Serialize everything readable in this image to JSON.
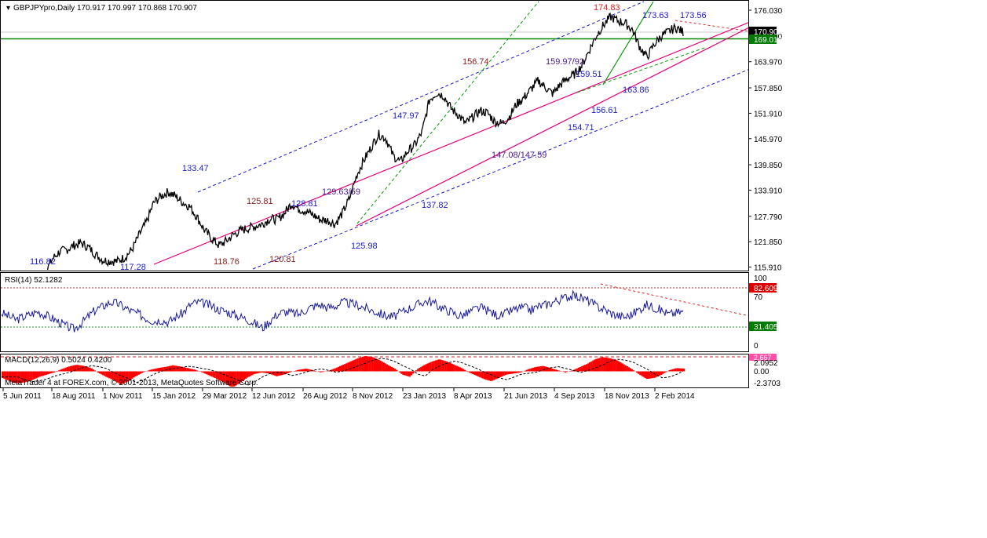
{
  "window": {
    "title": "GBPJPYpro,Daily",
    "ohlc": "170.917 170.997 170.868 170.907",
    "credit": "MetaTrader 4 at FOREX.com, © 2001-2013, MetaQuotes Software Corp."
  },
  "colors": {
    "price_line": "#000000",
    "channel_magenta": "#e8007a",
    "channel_blue": "#1a1acd",
    "trend_green": "#009900",
    "resistance_red": "#dd2222",
    "rsi_line": "#1a1a9a",
    "macd_hist": "#ff0000",
    "support_level": "#008800",
    "grid": "#c8c8c8"
  },
  "chart_data": [
    {
      "type": "line",
      "panel": "price",
      "series": [
        {
          "name": "GBPJPYpro,Daily",
          "values": [
            113.5,
            112.0,
            110.5,
            109.5,
            110.0,
            112.0,
            114.5,
            117.8,
            119.5,
            120.0,
            121.0,
            121.5,
            120.5,
            118.8,
            117.5,
            117.3,
            117.3,
            118.2,
            120.0,
            123.5,
            126.5,
            131.0,
            132.5,
            133.5,
            132.5,
            131.0,
            130.0,
            127.5,
            124.5,
            122.5,
            121.0,
            122.0,
            123.5,
            124.5,
            125.0,
            125.5,
            126.0,
            127.2,
            127.0,
            128.5,
            130.8,
            129.5,
            129.0,
            128.0,
            127.0,
            126.8,
            126.0,
            128.5,
            132.0,
            137.5,
            141.0,
            144.0,
            147.0,
            146.0,
            142.0,
            140.5,
            143.0,
            144.5,
            147.5,
            155.0,
            156.7,
            156.0,
            153.0,
            151.5,
            149.5,
            151.0,
            152.5,
            152.0,
            150.0,
            149.5,
            151.0,
            154.0,
            155.5,
            157.5,
            159.5,
            158.0,
            156.5,
            158.5,
            160.0,
            161.0,
            163.0,
            166.5,
            170.0,
            172.5,
            174.5,
            173.5,
            173.0,
            171.5,
            167.5,
            165.0,
            168.0,
            170.0,
            171.0,
            172.0,
            170.9
          ]
        }
      ],
      "y_axis_ticks": [
        176.03,
        169.99,
        163.97,
        157.85,
        151.91,
        145.97,
        139.85,
        133.91,
        127.79,
        121.85,
        115.91
      ],
      "ylim": [
        114.2,
        177.6
      ],
      "x_tick_labels": [
        "5 Jun 2011",
        "18 Aug 2011",
        "1 Nov 2011",
        "15 Jan 2012",
        "29 Mar 2012",
        "12 Jun 2012",
        "26 Aug 2012",
        "8 Nov 2012",
        "23 Jan 2013",
        "8 Apr 2013",
        "21 Jun 2013",
        "4 Sep 2013",
        "18 Nov 2013",
        "2 Feb 2014"
      ],
      "current_price": "170.907",
      "support_level": "169.016",
      "annotations": [
        "174.83",
        "173.63",
        "173.56",
        "156.74",
        "159.97/92",
        "159.51",
        "163.86",
        "156.61",
        "154.71",
        "147.97",
        "147.08/147.59",
        "137.82",
        "133.47",
        "125.81",
        "128.81",
        "129.63/59",
        "125.98",
        "118.76",
        "120.81",
        "116.82",
        "117.28"
      ]
    },
    {
      "type": "line",
      "panel": "rsi",
      "title": "RSI(14) 52.1282",
      "series": [
        {
          "name": "RSI(14)",
          "values": [
            50,
            45,
            40,
            44,
            48,
            52,
            47,
            42,
            36,
            30,
            26,
            35,
            45,
            55,
            60,
            66,
            64,
            58,
            52,
            48,
            42,
            38,
            40,
            36,
            44,
            50,
            62,
            66,
            64,
            60,
            55,
            52,
            48,
            44,
            40,
            34,
            28,
            38,
            48,
            52,
            50,
            48,
            55,
            60,
            62,
            58,
            60,
            66,
            64,
            62,
            58,
            54,
            50,
            46,
            44,
            50,
            56,
            60,
            66,
            68,
            62,
            56,
            52,
            46,
            48,
            54,
            58,
            54,
            48,
            46,
            52,
            56,
            58,
            54,
            60,
            62,
            66,
            70,
            74,
            76,
            72,
            68,
            60,
            56,
            50,
            46,
            44,
            48,
            56,
            62,
            58,
            54,
            48,
            50,
            52
          ]
        }
      ],
      "levels": [
        "100",
        "70",
        "0"
      ],
      "upper_level": "82.609",
      "lower_level": "31.405",
      "ylim": [
        0,
        100
      ]
    },
    {
      "type": "bar",
      "panel": "macd",
      "title": "MACD(12,26,9) 0.5024 0.4200",
      "series": [
        {
          "name": "MACD(12,26,9)",
          "values": [
            -1.2,
            -1.8,
            -2.2,
            -2.0,
            -1.6,
            -1.0,
            -0.6,
            -0.2,
            0.4,
            0.9,
            1.2,
            1.0,
            0.6,
            -0.3,
            -1.0,
            -1.6,
            -2.4,
            -1.8,
            -0.9,
            -0.2,
            0.3,
            0.6,
            0.8,
            1.1,
            0.9,
            0.6,
            0.3,
            -0.2,
            -0.8,
            -1.4,
            -2.1,
            -3.0,
            -2.2,
            -1.2,
            -0.5,
            -0.2,
            -0.4,
            -0.9,
            -0.6,
            -0.1,
            0.3,
            0.5,
            0.2,
            -0.2,
            0.1,
            0.6,
            1.2,
            1.8,
            2.4,
            2.8,
            2.6,
            2.0,
            1.2,
            0.5,
            -0.6,
            -1.0,
            0.4,
            1.2,
            1.8,
            2.2,
            1.8,
            1.2,
            0.6,
            -0.2,
            -0.8,
            -1.4,
            -1.8,
            -1.2,
            -0.6,
            -0.4,
            -0.2,
            0.4,
            0.8,
            1.0,
            0.6,
            0.2,
            -0.2,
            0.2,
            0.8,
            1.4,
            2.2,
            2.6,
            2.4,
            2.0,
            1.2,
            0.4,
            -0.6,
            -1.4,
            -1.2,
            -0.6,
            0.2,
            0.6,
            0.5
          ]
        }
      ],
      "levels": [
        "2.0952",
        "0.00",
        "-2.3703"
      ],
      "tag_label": "2.667",
      "ylim": [
        -3.4,
        3.2
      ]
    }
  ]
}
